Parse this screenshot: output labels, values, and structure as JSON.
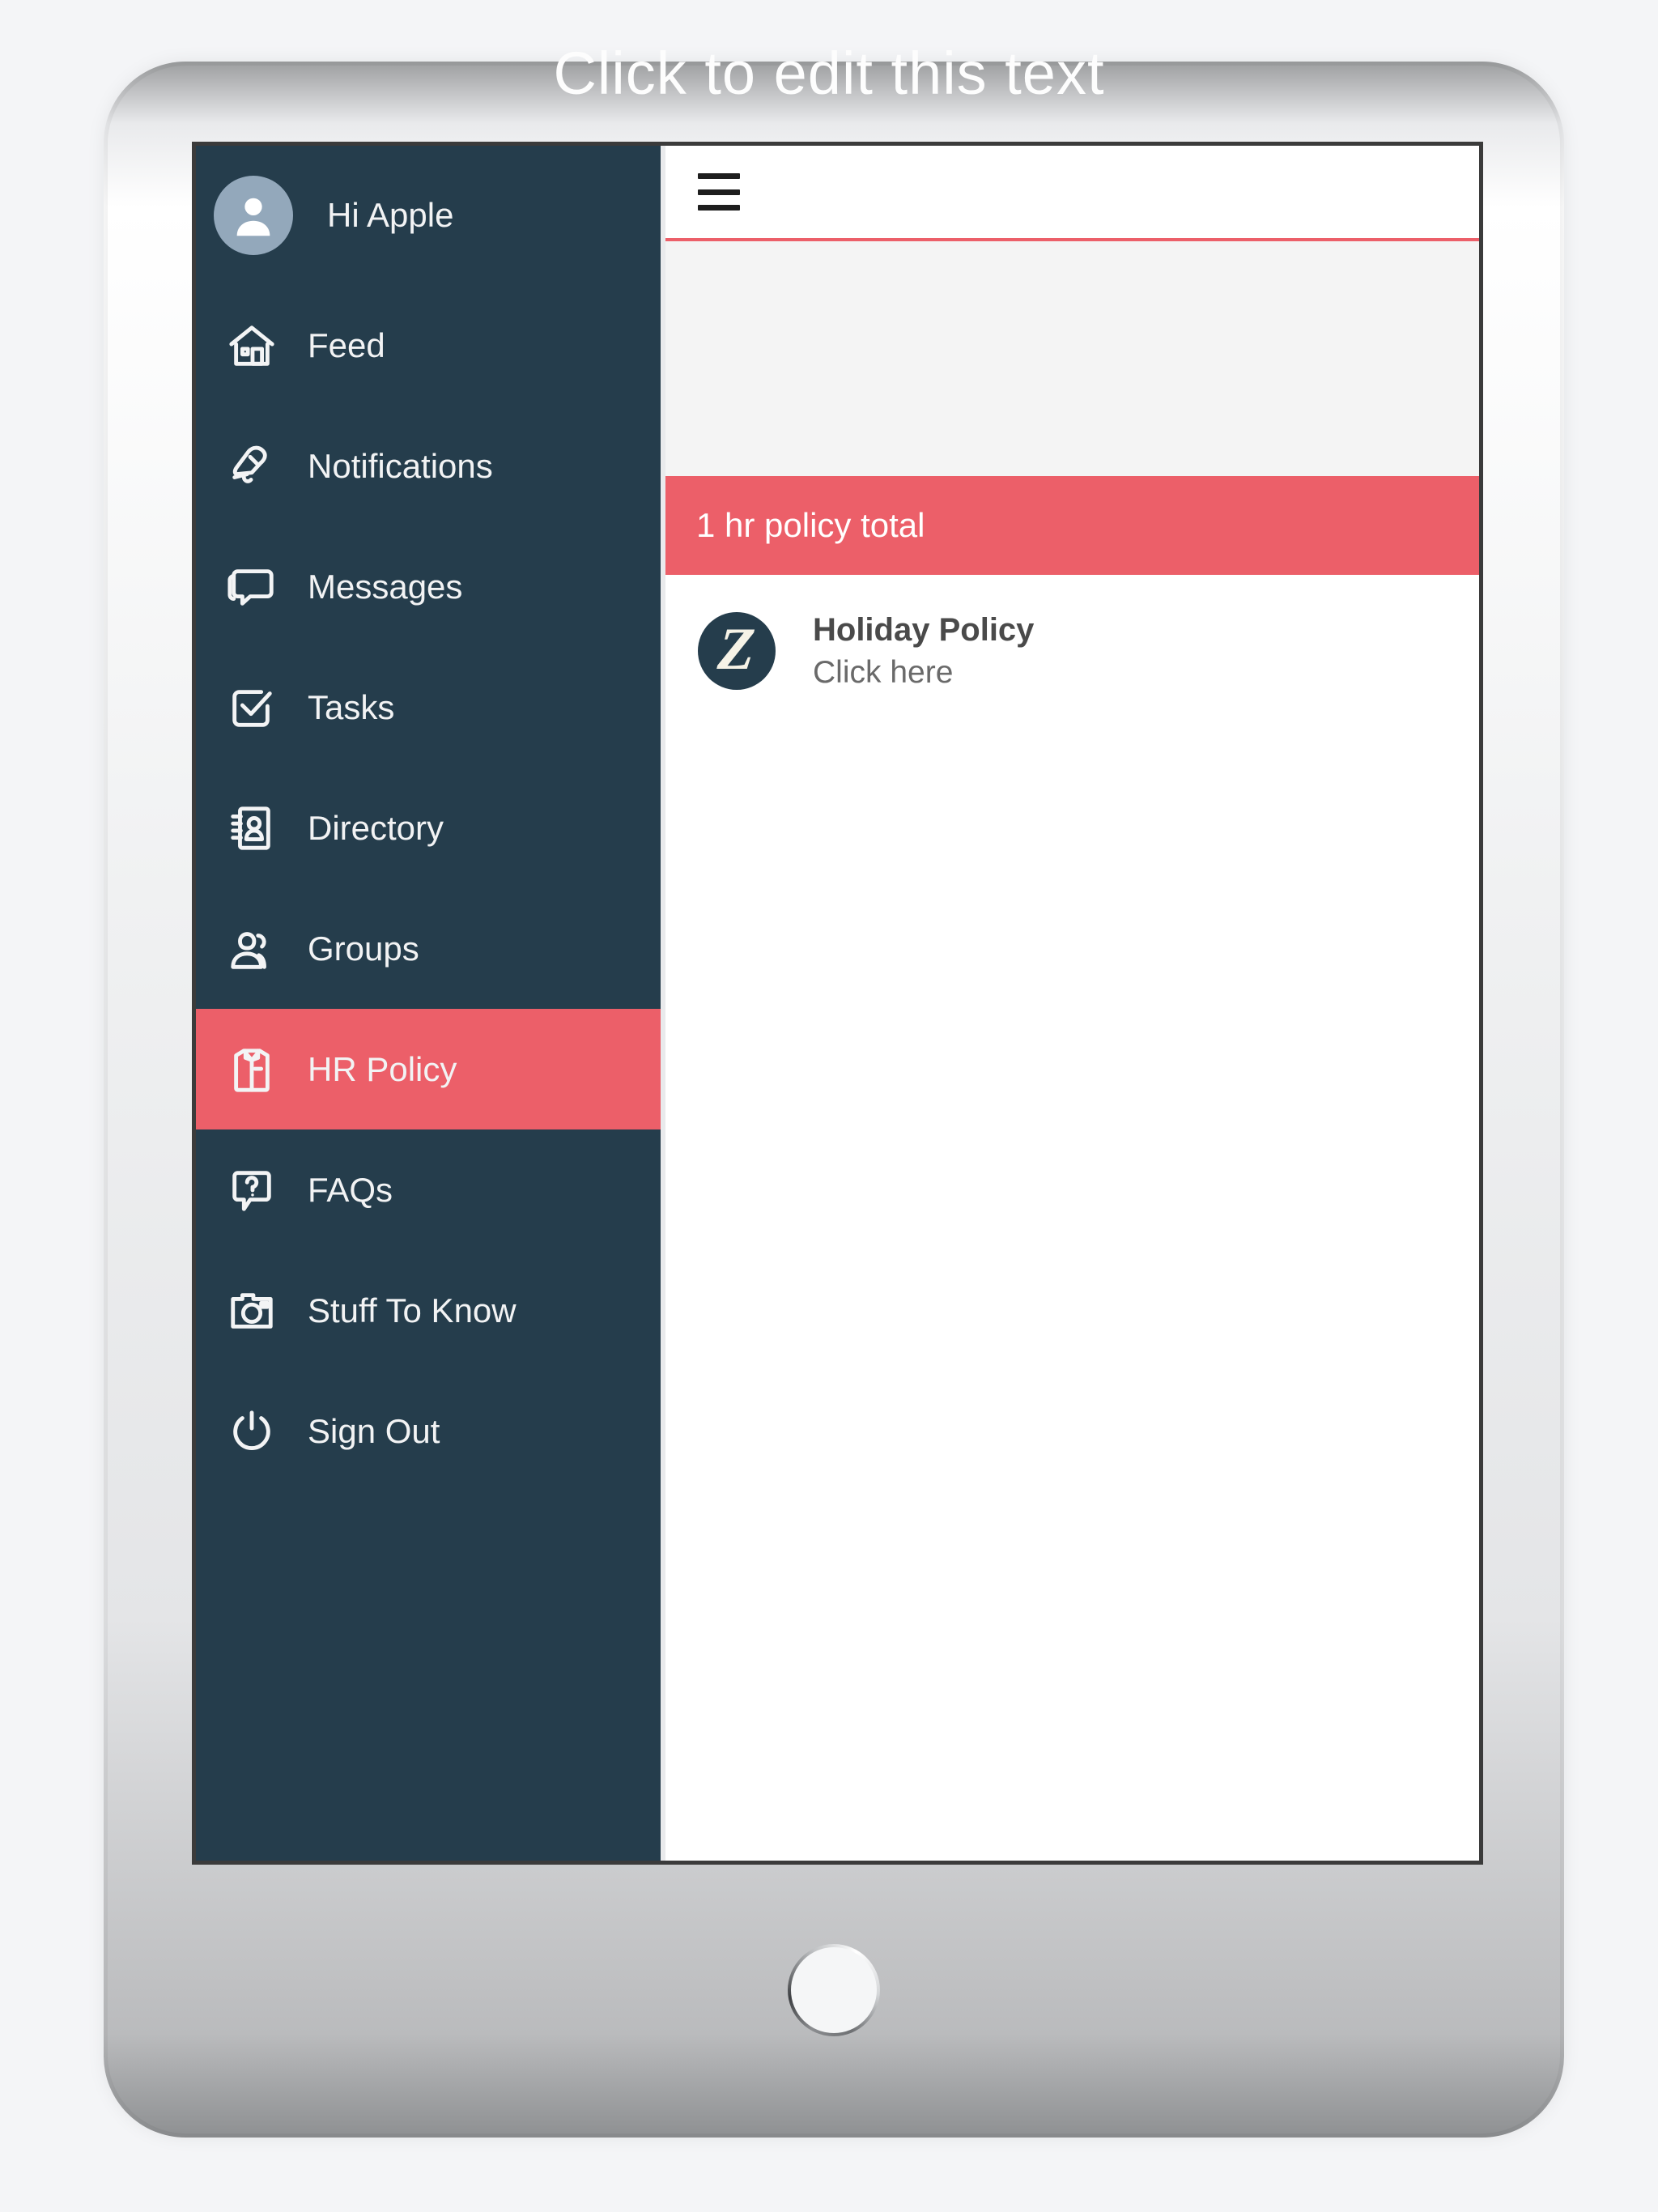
{
  "watermark": {
    "text": "Click to edit this text"
  },
  "device": {
    "camera_label": "front-camera",
    "home_button_label": "Home"
  },
  "sidebar": {
    "profile": {
      "greeting": "Hi Apple",
      "avatar_icon": "user-avatar-icon"
    },
    "items": [
      {
        "label": "Feed",
        "icon": "home-icon",
        "active": false
      },
      {
        "label": "Notifications",
        "icon": "bell-icon",
        "active": false
      },
      {
        "label": "Messages",
        "icon": "chat-bubble-icon",
        "active": false
      },
      {
        "label": "Tasks",
        "icon": "checkbox-icon",
        "active": false
      },
      {
        "label": "Directory",
        "icon": "address-book-icon",
        "active": false
      },
      {
        "label": "Groups",
        "icon": "group-users-icon",
        "active": false
      },
      {
        "label": "HR Policy",
        "icon": "shirt-icon",
        "active": true
      },
      {
        "label": "FAQs",
        "icon": "question-bubble-icon",
        "active": false
      },
      {
        "label": "Stuff To Know",
        "icon": "camera-icon",
        "active": false
      },
      {
        "label": "Sign Out",
        "icon": "power-icon",
        "active": false
      }
    ]
  },
  "header": {
    "menu_icon": "hamburger-menu-icon"
  },
  "main": {
    "banner": {
      "title": "1 hr policy total"
    },
    "policies": [
      {
        "logo_letter": "Z",
        "title": "Holiday Policy",
        "subtitle": "Click here"
      }
    ]
  },
  "colors": {
    "sidebar_bg": "#253d4c",
    "accent_red": "#ec5f69",
    "content_bg": "#f4f4f4",
    "text_light": "#f2f3f4",
    "avatar_bg": "#93a8bb"
  }
}
